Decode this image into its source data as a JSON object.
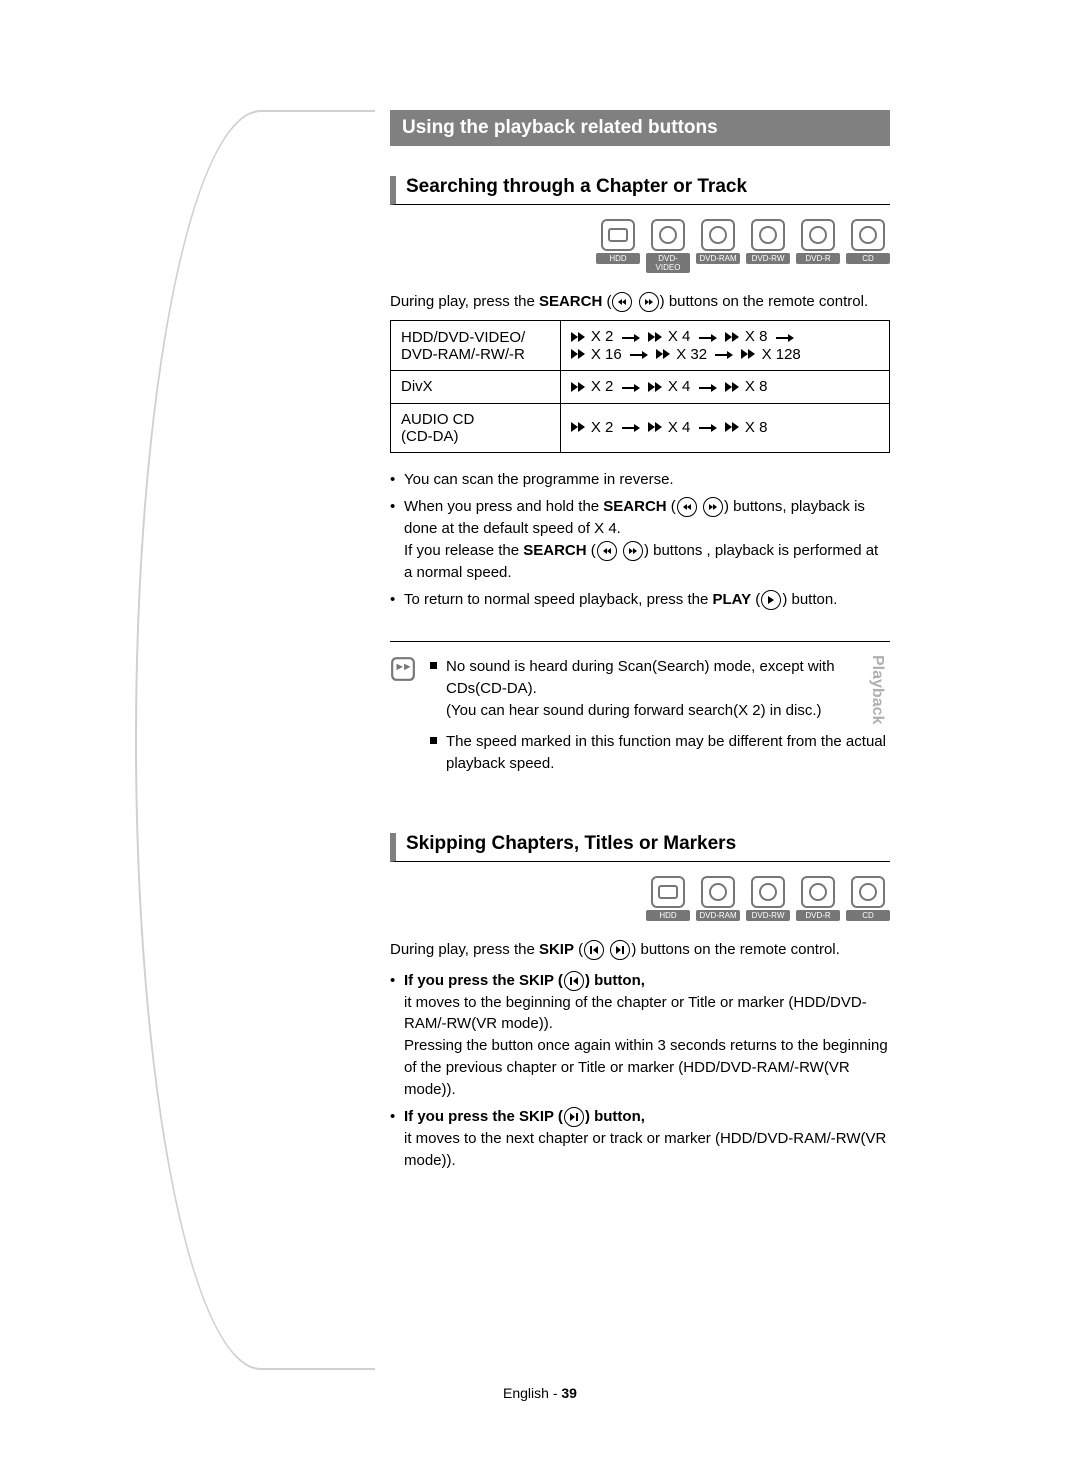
{
  "side_tab": "Playback",
  "section_bar": "Using the playback related buttons",
  "sub1": {
    "heading": "Searching through a Chapter or Track",
    "disc_badges": [
      "HDD",
      "DVD-VIDEO",
      "DVD-RAM",
      "DVD-RW",
      "DVD-R",
      "CD"
    ],
    "intro_pre": "During play, press the ",
    "intro_bold": "SEARCH",
    "intro_post": " buttons on the remote control.",
    "table": {
      "r1_left_a": "HDD/DVD-VIDEO/",
      "r1_left_b": "DVD-RAM/-RW/-R",
      "r1_speeds_a": [
        "X 2",
        "X 4",
        "X 8"
      ],
      "r1_speeds_b": [
        "X 16",
        "X 32",
        "X 128"
      ],
      "r2_left": "DivX",
      "r2_speeds": [
        "X 2",
        "X 4",
        "X 8"
      ],
      "r3_left_a": "AUDIO CD",
      "r3_left_b": "(CD-DA)",
      "r3_speeds": [
        "X 2",
        "X 4",
        "X 8"
      ]
    },
    "bullets": {
      "b1": "You can scan the programme in reverse.",
      "b2_pre": "When you press and hold the ",
      "b2_bold": "SEARCH",
      "b2_post": " buttons, playback is done at the default speed of X 4.",
      "b2_line2_pre": "If you release the ",
      "b2_line2_bold": "SEARCH",
      "b2_line2_post": " buttons , playback is performed at a normal speed.",
      "b3_pre": "To return to normal speed playback, press the ",
      "b3_bold": "PLAY",
      "b3_post": " button."
    },
    "notes": {
      "n1_a": "No sound is heard during Scan(Search) mode, except with CDs(CD-DA).",
      "n1_b": "(You can hear sound during forward search(X 2) in disc.)",
      "n2": "The speed marked in this function may be different from the actual playback speed."
    }
  },
  "sub2": {
    "heading": "Skipping Chapters, Titles or Markers",
    "disc_badges": [
      "HDD",
      "DVD-RAM",
      "DVD-RW",
      "DVD-R",
      "CD"
    ],
    "intro_pre": "During play, press the ",
    "intro_bold": "SKIP",
    "intro_post": " buttons on the remote control.",
    "b1_title_pre": "If you press the SKIP (",
    "b1_title_post": ") button,",
    "b1_body": "it moves to the beginning of the chapter or Title or marker (HDD/DVD-RAM/-RW(VR mode)).",
    "b1_body2": "Pressing the button once again within 3 seconds returns to the beginning of the previous chapter or Title or marker (HDD/DVD-RAM/-RW(VR mode)).",
    "b2_title_pre": "If you press the SKIP (",
    "b2_title_post": ") button,",
    "b2_body": "it moves to the next chapter or track or marker (HDD/DVD-RAM/-RW(VR mode))."
  },
  "footer_lang": "English",
  "footer_sep": " - ",
  "footer_page": "39"
}
